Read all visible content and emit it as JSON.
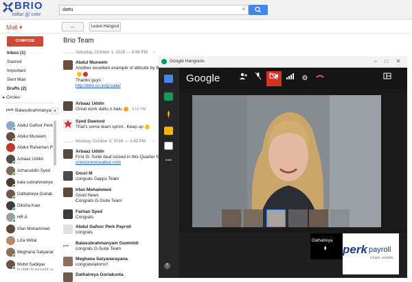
{
  "header": {
    "logo_brand": "BRIO",
    "logo_tagline": "value @ core",
    "search_value": "dattu"
  },
  "toolbar": {
    "mail_label": "Mail ▾",
    "back_label": "←",
    "leave_label": "Leave Hangout"
  },
  "nav": {
    "compose": "COMPOSE",
    "items": [
      "Inbox (1)",
      "Starred",
      "Important",
      "Sent Mail",
      "Drafts (2)"
    ],
    "circles": "▸ Circles"
  },
  "contacts": {
    "self": "Balasubrahmanyam",
    "list": [
      "Abdul Gafoor Perk",
      "Abdul Muneem",
      "Abdur Rahaman P",
      "Arbaaz Uddin",
      "Azharuddin Syed",
      "bala subrahmanya",
      "Dathatreya Gorlak",
      "Diksha Kaw",
      "HR A",
      "Irfan Mohammed",
      "Liza Mittal",
      "Meghana Satyanar",
      "Mohd Sadique"
    ],
    "status_line": "In order to succeed, w"
  },
  "conversation": {
    "title": "Brio Team",
    "date1": "Saturday, October 1, 2016 — 9:46 PM",
    "date2": "Monday, October 3, 2016 — 3:41 PM",
    "messages": [
      {
        "name": "Abdul Muneem",
        "line1": "Another excellent example of attitude by Balu",
        "line2": "Thanks guys",
        "link": "http://brio.co.in/g-suite/"
      },
      {
        "name": "Arbaaz Uddin",
        "line1": "Great work dattu n balu",
        "time": "9:52 PM"
      },
      {
        "name": "Syed Dawood",
        "line1": "That's some team sprint.. Keep up"
      },
      {
        "name": "Arbaaz Uddin",
        "line1": "First G- Suite deal closed in this Quarter for 30",
        "link": "crimsoninnovative.com"
      },
      {
        "name": "Gouri M",
        "line1": "congrats Gapps Team"
      },
      {
        "name": "Irfan Mohammed",
        "line1": "Good News",
        "line2": "Congrats G-Suite Team"
      },
      {
        "name": "Farhan Syed",
        "line1": "Congrats"
      },
      {
        "name": "Abdul Gafoor Perk Payroll",
        "line1": "congrats"
      },
      {
        "name": "Balasubrahmanyam Gummidi",
        "line1": "congrats G-Suite Team"
      },
      {
        "name": "Meghana Satyanarayana",
        "line1": "congratulations!!"
      },
      {
        "name": "Dathatreya Gorlakunta",
        "line1": ""
      }
    ]
  },
  "hangout": {
    "window_title": "Google Hangouts",
    "brand": "Google",
    "participant_name": "Dathatreya",
    "perk_brand_1": "perk",
    "perk_brand_2": "payroll",
    "perk_slogan": "simple. reliable.",
    "help": "?"
  },
  "colors": {
    "accent": "#d14836",
    "search": "#4285f4",
    "mute_active": "#d93025",
    "online": "#1ea362"
  }
}
